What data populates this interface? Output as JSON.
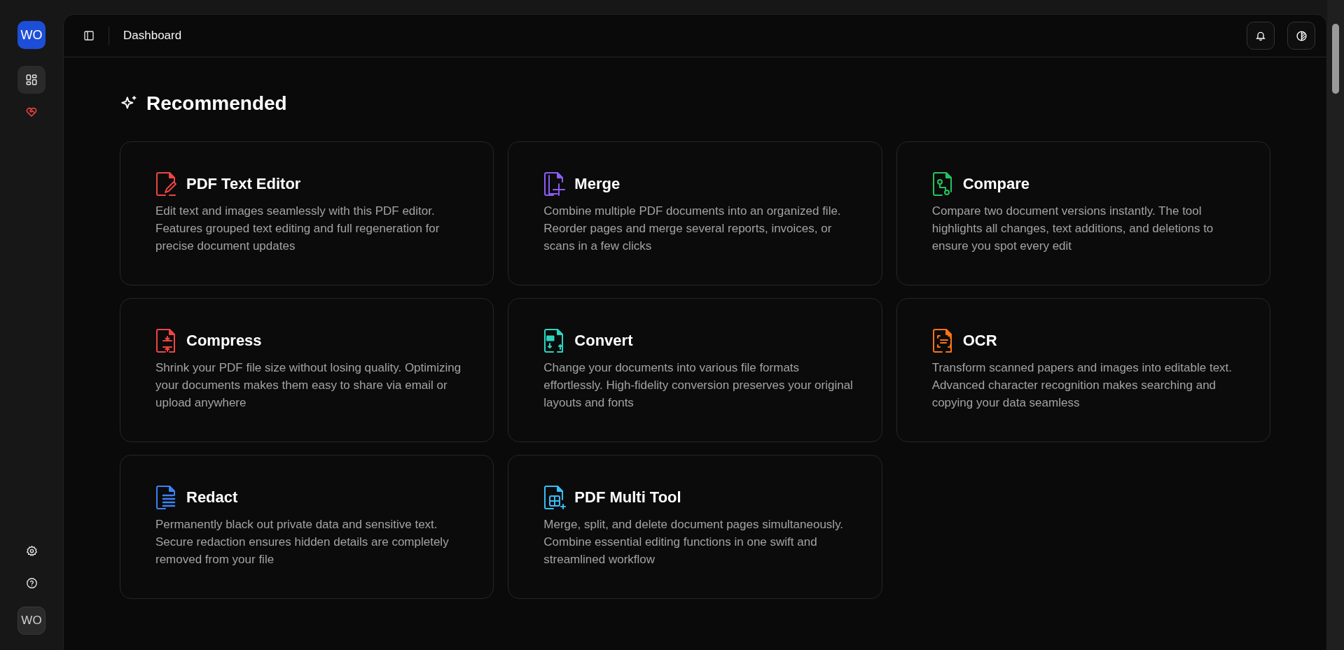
{
  "sidebar": {
    "logo": "WO",
    "nav": [
      {
        "kind": "grid",
        "selected": true
      },
      {
        "kind": "heart",
        "selected": false
      }
    ],
    "bottom": [
      {
        "kind": "settings"
      },
      {
        "kind": "help"
      }
    ],
    "user": "WO"
  },
  "header": {
    "title": "Dashboard"
  },
  "section": {
    "title": "Recommended"
  },
  "tools": [
    {
      "kind": "edit",
      "color": "#ef4444",
      "title": "PDF Text Editor",
      "description": "Edit text and images seamlessly with this PDF editor. Features grouped text editing and full regeneration for precise document updates"
    },
    {
      "kind": "merge",
      "color": "#8b5cf6",
      "title": "Merge",
      "description": "Combine multiple PDF documents into an organized file. Reorder pages and merge several reports, invoices, or scans in a few clicks"
    },
    {
      "kind": "compare",
      "color": "#22c55e",
      "title": "Compare",
      "description": "Compare two document versions instantly. The tool highlights all changes, text additions, and deletions to ensure you spot every edit"
    },
    {
      "kind": "compress",
      "color": "#ef4444",
      "title": "Compress",
      "description": "Shrink your PDF file size without losing quality. Optimizing your documents makes them easy to share via email or upload anywhere"
    },
    {
      "kind": "convert",
      "color": "#2dd4bf",
      "title": "Convert",
      "description": "Change your documents into various file formats effortlessly. High-fidelity conversion preserves your original layouts and fonts"
    },
    {
      "kind": "ocr",
      "color": "#f97316",
      "title": "OCR",
      "description": "Transform scanned papers and images into editable text. Advanced character recognition makes searching and copying your data seamless"
    },
    {
      "kind": "redact",
      "color": "#3b82f6",
      "title": "Redact",
      "description": "Permanently black out private data and sensitive text. Secure redaction ensures hidden details are completely removed from your file"
    },
    {
      "kind": "multi",
      "color": "#38bdf8",
      "title": "PDF Multi Tool",
      "description": "Merge, split, and delete document pages simultaneously. Combine essential editing functions in one swift and streamlined workflow"
    }
  ]
}
